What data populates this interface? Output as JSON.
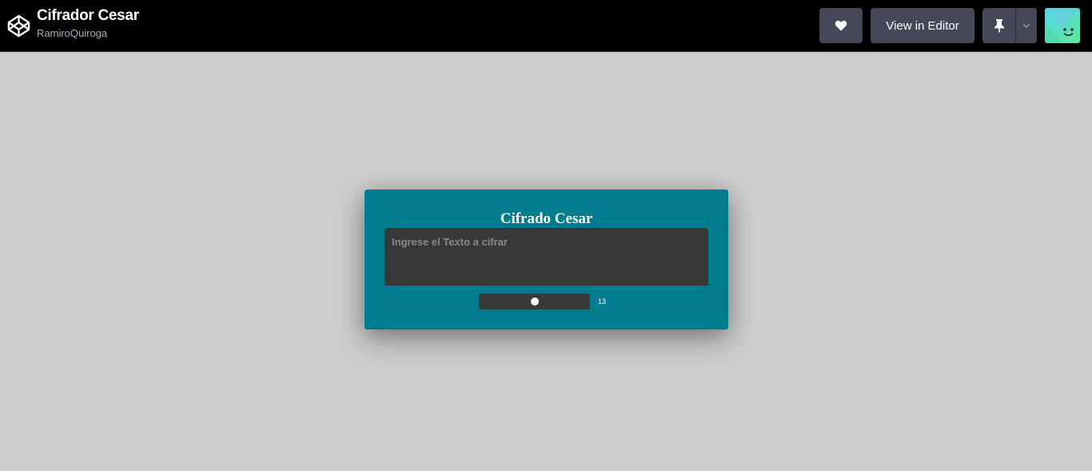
{
  "header": {
    "pen_title": "Cifrador Cesar",
    "author": "RamiroQuiroga",
    "logo_icon": "codepen-logo-icon",
    "like_icon": "heart-icon",
    "view_editor_label": "View in Editor",
    "pin_icon": "pin-icon",
    "dropdown_icon": "chevron-down-icon",
    "avatar_icon": "user-avatar-smiley"
  },
  "app": {
    "title": "Cifrado Cesar",
    "input_placeholder": "Ingrese el Texto a cifrar",
    "input_value": "",
    "shift_value": "13",
    "shift_fraction": 0.5
  },
  "colors": {
    "topbar": "#000000",
    "button": "#444857",
    "page_background": "#cecece",
    "card": "#007c8e",
    "input": "#383838"
  }
}
